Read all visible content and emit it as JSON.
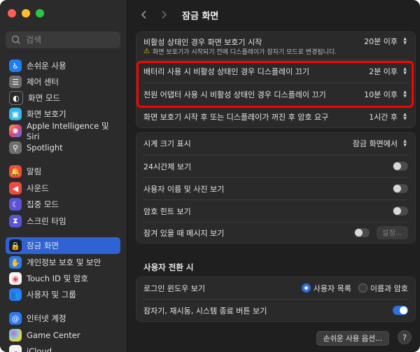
{
  "window": {
    "traffic_colors": [
      "#fe5f57",
      "#febc2e",
      "#28c840"
    ]
  },
  "search": {
    "placeholder": "검색"
  },
  "sidebar": {
    "items": [
      {
        "label": "손쉬운 사용",
        "icon": "accessibility-icon",
        "color": "#1e7cf5"
      },
      {
        "label": "제어 센터",
        "icon": "control-center-icon",
        "color": "#6f6f72"
      },
      {
        "label": "화면 모드",
        "icon": "appearance-icon",
        "color": "#2b2b2b"
      },
      {
        "label": "화면 보호기",
        "icon": "screen-saver-icon",
        "color": "#35b6e8"
      },
      {
        "label": "Apple Intelligence 및 Siri",
        "icon": "siri-icon",
        "color": "#e98a2d"
      },
      {
        "label": "Spotlight",
        "icon": "spotlight-icon",
        "color": "#6f6f72"
      },
      {
        "label": "알림",
        "icon": "notifications-icon",
        "color": "#f0493d"
      },
      {
        "label": "사운드",
        "icon": "sound-icon",
        "color": "#f0493d"
      },
      {
        "label": "집중 모드",
        "icon": "focus-icon",
        "color": "#5b54d6"
      },
      {
        "label": "스크린 타임",
        "icon": "screen-time-icon",
        "color": "#5b54d6"
      },
      {
        "label": "잠금 화면",
        "icon": "lock-screen-icon",
        "color": "#1c1c1c"
      },
      {
        "label": "개인정보 보호 및 보안",
        "icon": "privacy-icon",
        "color": "#2a7cf6"
      },
      {
        "label": "Touch ID 및 암호",
        "icon": "touch-id-icon",
        "color": "#f3f3f3"
      },
      {
        "label": "사용자 및 그룹",
        "icon": "users-icon",
        "color": "#2a7cf6"
      },
      {
        "label": "인터넷 계정",
        "icon": "internet-accounts-icon",
        "color": "#2a7cf6"
      },
      {
        "label": "Game Center",
        "icon": "game-center-icon",
        "color": "#f3f3f3"
      },
      {
        "label": "iCloud",
        "icon": "icloud-icon",
        "color": "#f3f3f3"
      }
    ]
  },
  "header": {
    "title": "잠금 화면",
    "back_icon": "chevron-left-icon",
    "forward_icon": "chevron-right-icon"
  },
  "group1": {
    "rows": [
      {
        "label": "비활성 상태인 경우 화면 보호기 시작",
        "note": "화면 보호기가 시작되기 전에 디스플레이가 잠자기 모드로 변경됩니다.",
        "value": "20분 이후"
      },
      {
        "label": "배터리 사용 시 비활성 상태인 경우 디스플레이 끄기",
        "value": "2분 이후"
      },
      {
        "label": "전원 어댑터 사용 시 비활성 상태인 경우 디스플레이 끄기",
        "value": "10분 이후"
      },
      {
        "label": "화면 보호기 시작 후 또는 디스플레이가 꺼진 후 암호 요구",
        "value": "1시간 후"
      }
    ]
  },
  "group2": {
    "clock_label": "시계 크기 표시",
    "clock_value": "잠금 화면에서",
    "rows": [
      {
        "label": "24시간제 보기",
        "on": false
      },
      {
        "label": "사용자 이름 및 사진 보기",
        "on": false
      },
      {
        "label": "암호 힌트 보기",
        "on": false
      }
    ],
    "message_label": "잠겨 있을 때 메시지 보기",
    "message_button": "설정..."
  },
  "section_title": "사용자 전환 시",
  "group3": {
    "login_label": "로그인 윈도우 보기",
    "login_options": [
      "사용자 목록",
      "이름과 암호"
    ],
    "login_selected": "사용자 목록",
    "buttons_label": "잠자기, 재시동, 시스템 종료 버튼 보기",
    "buttons_on": true
  },
  "footer": {
    "accessibility_button": "손쉬운 사용 옵션...",
    "help_button": "?"
  },
  "highlight_color": "#ff0000"
}
